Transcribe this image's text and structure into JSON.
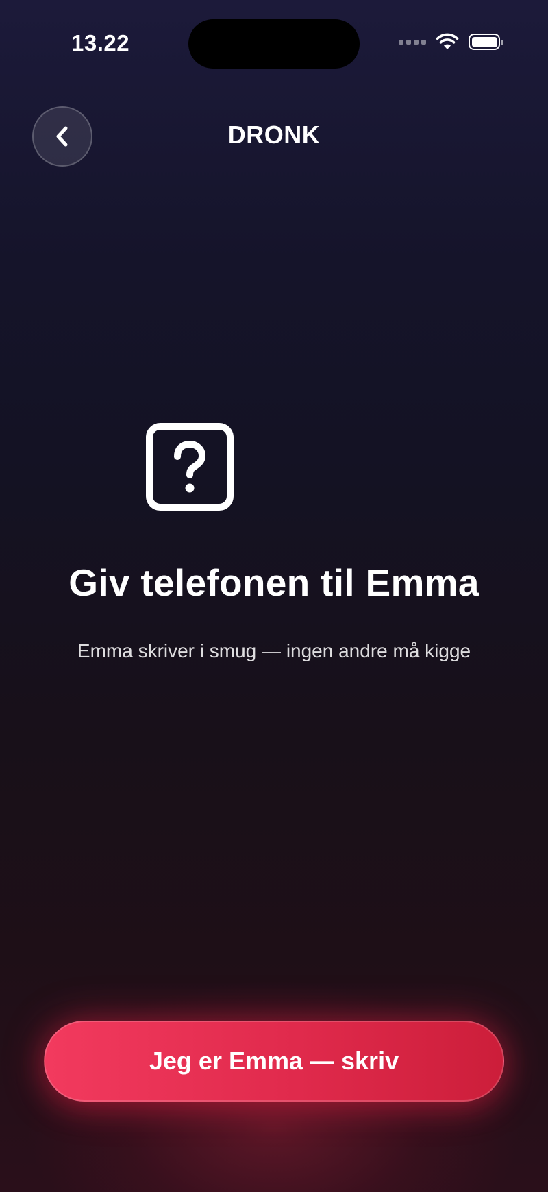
{
  "status_bar": {
    "time": "13.22"
  },
  "nav": {
    "title": "DRONK",
    "back_icon": "chevron-left-icon"
  },
  "prompt": {
    "icon": "question-square-icon",
    "heading": "Giv telefonen til Emma",
    "subtext": "Emma skriver i smug — ingen andre må kigge"
  },
  "cta": {
    "label": "Jeg er Emma — skriv"
  },
  "colors": {
    "accent": "#e8304f",
    "background_top": "#1c1a3a",
    "background_bottom": "#2a0f1a"
  }
}
